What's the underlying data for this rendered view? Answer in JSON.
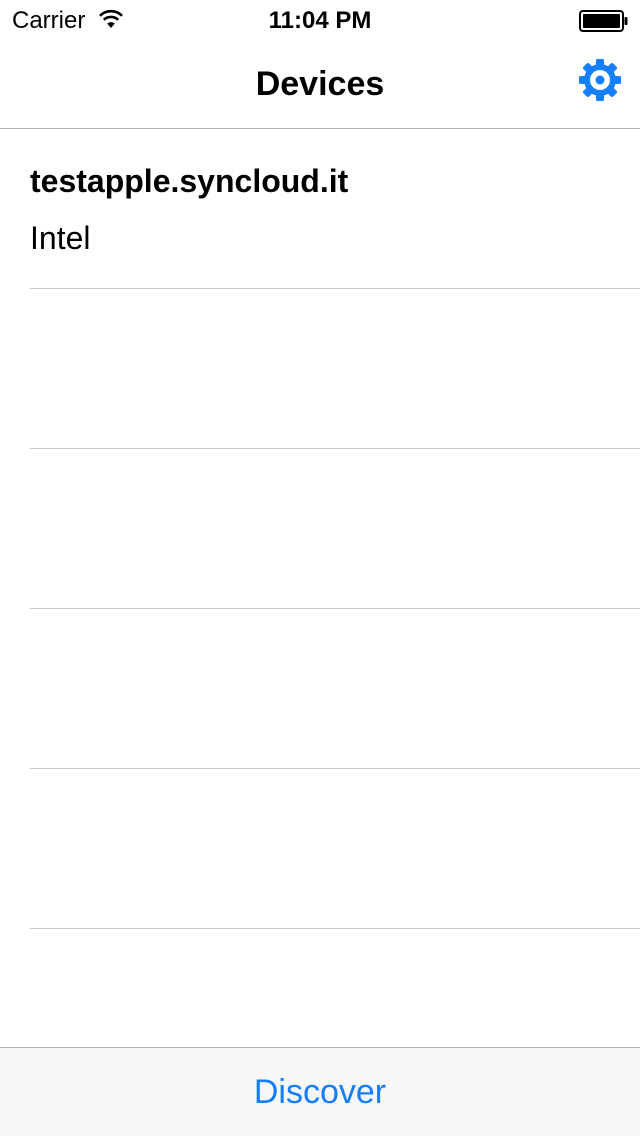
{
  "status_bar": {
    "carrier": "Carrier",
    "time": "11:04 PM",
    "wifi_icon": "wifi-icon",
    "battery_icon": "battery-full-icon"
  },
  "nav": {
    "title": "Devices",
    "settings_icon": "gear-icon"
  },
  "devices": [
    {
      "name": "testapple.syncloud.it",
      "detail": "Intel"
    }
  ],
  "toolbar": {
    "discover_label": "Discover"
  },
  "colors": {
    "accent": "#157efb",
    "separator": "#c8c7cc",
    "toolbar_bg": "#f7f7f7"
  }
}
